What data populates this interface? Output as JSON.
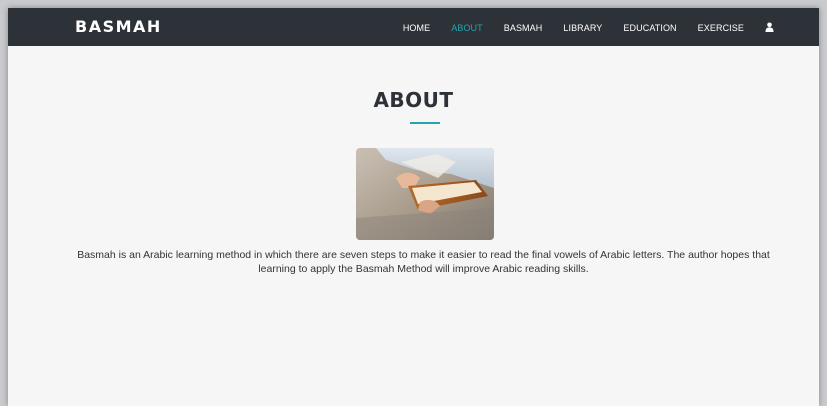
{
  "brand": "BASMAH",
  "nav": {
    "items": [
      {
        "label": "HOME"
      },
      {
        "label": "ABOUT"
      },
      {
        "label": "BASMAH"
      },
      {
        "label": "LIBRARY"
      },
      {
        "label": "EDUCATION"
      },
      {
        "label": "EXERCISE"
      }
    ],
    "active": "ABOUT",
    "user_icon": "user-icon"
  },
  "page": {
    "title": "ABOUT",
    "description": "Basmah is an Arabic learning method in which there are seven steps to make it easier to read the final vowels of Arabic letters. The author hopes that learning to apply the Basmah Method will improve Arabic reading skills."
  },
  "colors": {
    "navbar": "#2d3238",
    "accent": "#26a3ae",
    "background": "#f5f6f5"
  }
}
